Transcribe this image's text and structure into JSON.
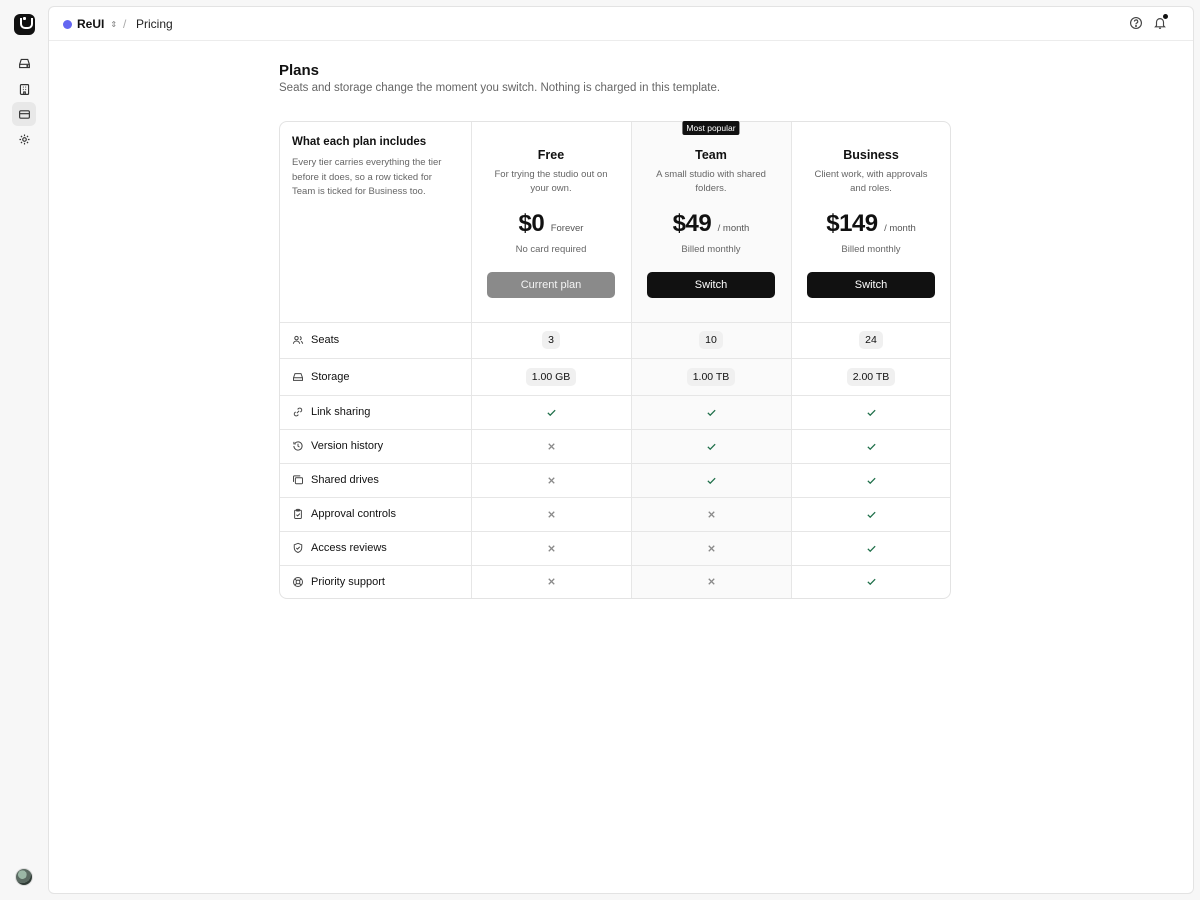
{
  "workspace": {
    "name": "ReUI",
    "dot_color": "#6366f1"
  },
  "breadcrumb": {
    "separator": "/",
    "page": "Pricing"
  },
  "page": {
    "title": "Plans",
    "subtitle": "Seats and storage change the moment you switch. Nothing is charged in this template."
  },
  "intro": {
    "title": "What each plan includes",
    "text": "Every tier carries everything the tier before it does, so a row ticked for Team is ticked for Business too."
  },
  "plans": [
    {
      "name": "Free",
      "description": "For trying the studio out on your own.",
      "price": "$0",
      "period": "Forever",
      "billing": "No card required",
      "button": "Current plan",
      "badge": ""
    },
    {
      "name": "Team",
      "description": "A small studio with shared folders.",
      "price": "$49",
      "period": "/ month",
      "billing": "Billed monthly",
      "button": "Switch",
      "badge": "Most popular"
    },
    {
      "name": "Business",
      "description": "Client work, with approvals and roles.",
      "price": "$149",
      "period": "/ month",
      "billing": "Billed monthly",
      "button": "Switch",
      "badge": ""
    }
  ],
  "features": [
    {
      "label": "Seats",
      "icon": "users-icon",
      "values": [
        "3",
        "10",
        "24"
      ]
    },
    {
      "label": "Storage",
      "icon": "drive-icon",
      "values": [
        "1.00 GB",
        "1.00 TB",
        "2.00 TB"
      ]
    },
    {
      "label": "Link sharing",
      "icon": "link-icon",
      "values": [
        true,
        true,
        true
      ]
    },
    {
      "label": "Version history",
      "icon": "history-icon",
      "values": [
        false,
        true,
        true
      ]
    },
    {
      "label": "Shared drives",
      "icon": "shared-drives-icon",
      "values": [
        false,
        true,
        true
      ]
    },
    {
      "label": "Approval controls",
      "icon": "clipboard-check-icon",
      "values": [
        false,
        false,
        true
      ]
    },
    {
      "label": "Access reviews",
      "icon": "shield-check-icon",
      "values": [
        false,
        false,
        true
      ]
    },
    {
      "label": "Priority support",
      "icon": "lifebuoy-icon",
      "values": [
        false,
        false,
        true
      ]
    }
  ],
  "colors": {
    "check": "#1f6f4a",
    "cross": "#8a8a8a",
    "primary": "#111111"
  }
}
